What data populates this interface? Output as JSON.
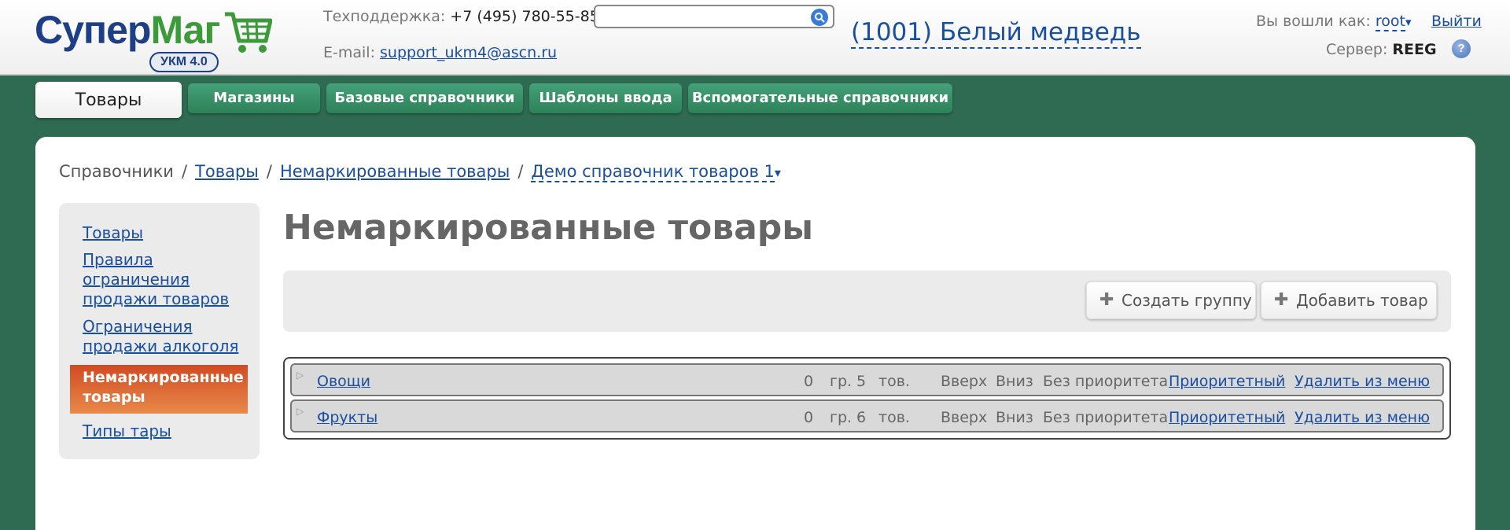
{
  "brand": {
    "name_a": "Супер",
    "name_b": "Маг",
    "badge": "УКМ 4.0"
  },
  "header": {
    "support_label": "Техподдержка:",
    "support_phone": "+7 (495) 780-55-85",
    "email_label": "E-mail:",
    "email": "support_ukm4@ascn.ru",
    "search_value": "",
    "shop": "(1001) Белый медведь",
    "login_label": "Вы вошли как:",
    "user": "root",
    "caret": "▾",
    "logout": "Выйти",
    "server_label": "Сервер:",
    "server": "REEG",
    "help": "?"
  },
  "tabs": [
    {
      "label": "Товары"
    },
    {
      "label": "Магазины"
    },
    {
      "label": "Базовые справочники"
    },
    {
      "label": "Шаблоны ввода"
    },
    {
      "label": "Вспомогательные справочники"
    }
  ],
  "breadcrumb": {
    "root": "Справочники",
    "sep": "/",
    "items": [
      "Товары",
      "Немаркированные товары",
      "Демо справочник товаров 1"
    ],
    "caret": "▾"
  },
  "sidebar": {
    "items": [
      {
        "label": "Товары"
      },
      {
        "label": "Правила ограничения продажи товаров"
      },
      {
        "label": "Ограничения продажи алкоголя"
      },
      {
        "label": "Немаркированные товары"
      },
      {
        "label": "Типы тары"
      }
    ]
  },
  "main": {
    "title": "Немаркированные товары",
    "create_group": "Создать группу",
    "add_item": "Добавить товар",
    "plus": "✚",
    "rows": [
      {
        "name": "Овощи",
        "groups": "0",
        "gr_label": "гр.",
        "items": "5",
        "tov_label": "тов.",
        "up": "Вверх",
        "down": "Вниз",
        "no_priority": "Без приоритета",
        "priority": "Приоритетный",
        "remove": "Удалить из меню"
      },
      {
        "name": "Фрукты",
        "groups": "0",
        "gr_label": "гр.",
        "items": "6",
        "tov_label": "тов.",
        "up": "Вверх",
        "down": "Вниз",
        "no_priority": "Без приоритета",
        "priority": "Приоритетный",
        "remove": "Удалить из меню"
      }
    ]
  },
  "colors": {
    "accent": "#2f6b52",
    "active_menu": "#d14a22",
    "link": "#1a4fa0"
  }
}
